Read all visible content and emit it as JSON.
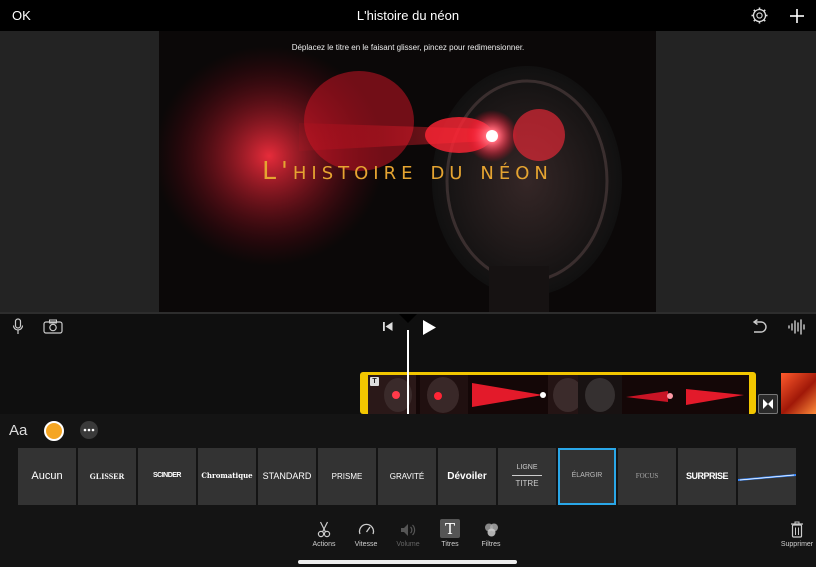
{
  "topbar": {
    "ok_label": "OK",
    "title": "L'histoire du néon"
  },
  "viewer": {
    "hint": "Déplacez le titre en le faisant glisser, pincez pour redimensionner.",
    "overlay_title": "L'histoire du néon"
  },
  "panel": {
    "font_label": "Aa",
    "selected_color": "#f5a623",
    "accent_color": "#2aa7e8",
    "title_styles": [
      {
        "label": "Aucun"
      },
      {
        "label": "GLISSER"
      },
      {
        "label": "SCINDER"
      },
      {
        "label": "Chromatique"
      },
      {
        "label": "STANDARD"
      },
      {
        "label": "PRISME"
      },
      {
        "label": "GRAVITÉ"
      },
      {
        "label": "Dévoiler"
      },
      {
        "label": "LIGNE TITRE",
        "line1": "LIGNE",
        "line2": "TITRE"
      },
      {
        "label": "ÉLARGIR",
        "selected": true
      },
      {
        "label": "FOCUS"
      },
      {
        "label": "SURPRISE"
      },
      {
        "label": ""
      }
    ]
  },
  "toolbar": {
    "actions": "Actions",
    "speed": "Vitesse",
    "volume": "Volume",
    "titles": "Titres",
    "filters": "Filtres",
    "delete": "Supprimer"
  }
}
